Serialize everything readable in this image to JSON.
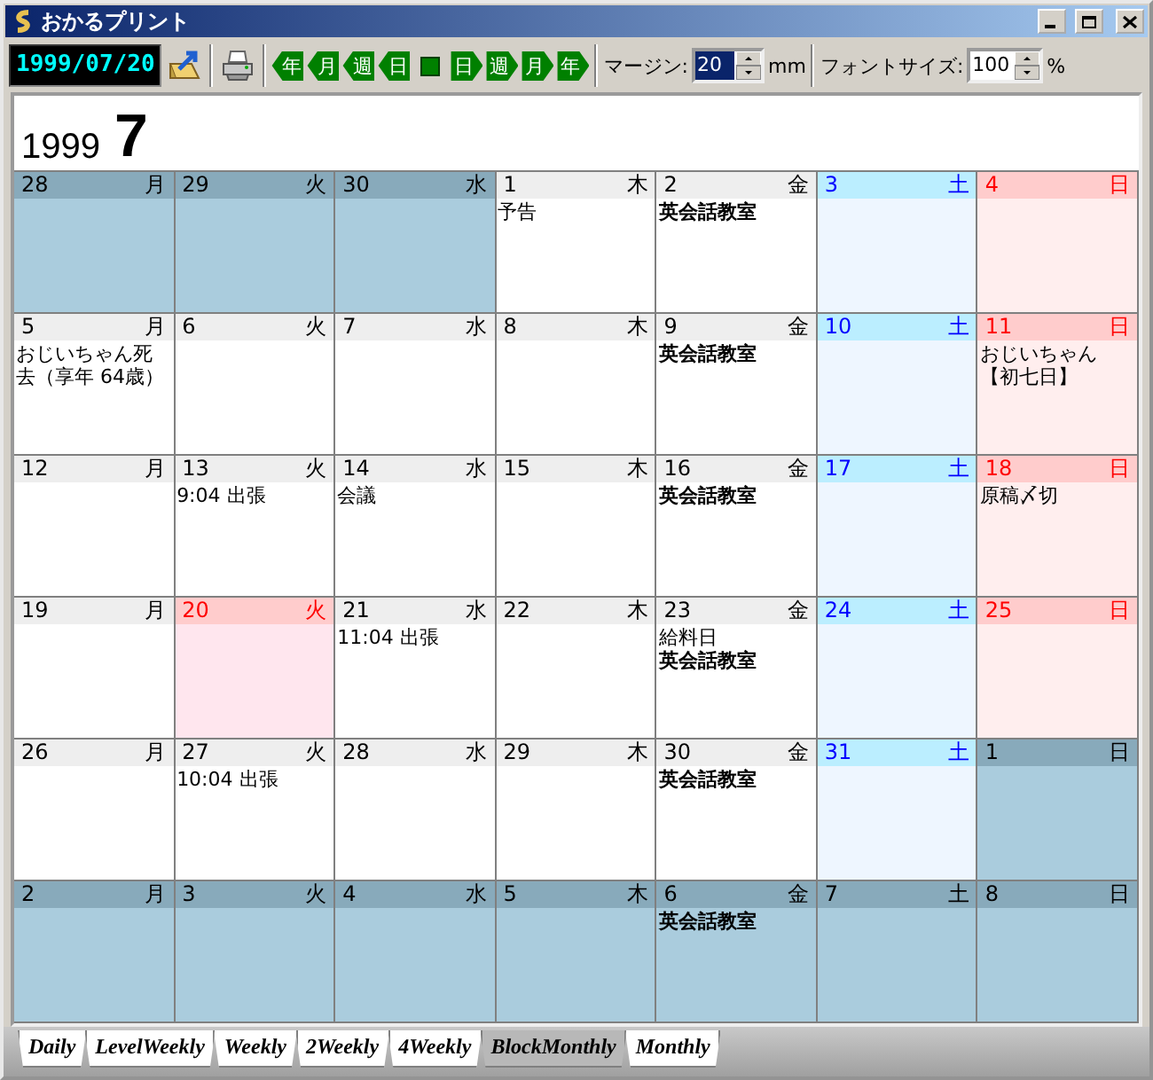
{
  "window": {
    "title": "おかるプリント"
  },
  "toolbar": {
    "date": "1999/07/20",
    "nav": [
      {
        "label": "年",
        "kind": "back"
      },
      {
        "label": "月",
        "kind": "back"
      },
      {
        "label": "週",
        "kind": "back"
      },
      {
        "label": "日",
        "kind": "back"
      },
      {
        "kind": "today"
      },
      {
        "label": "日",
        "kind": "forward"
      },
      {
        "label": "週",
        "kind": "forward"
      },
      {
        "label": "月",
        "kind": "forward"
      },
      {
        "label": "年",
        "kind": "forward"
      }
    ],
    "margin": {
      "label": "マージン:",
      "value": "20",
      "unit": "mm"
    },
    "font_size": {
      "label": "フォントサイズ:",
      "value": "100",
      "unit": "%"
    }
  },
  "heading": {
    "year": "1999",
    "month": "7"
  },
  "weeks": [
    [
      {
        "day": "28",
        "weekday": "月",
        "kind": "other"
      },
      {
        "day": "29",
        "weekday": "火",
        "kind": "other"
      },
      {
        "day": "30",
        "weekday": "水",
        "kind": "other"
      },
      {
        "day": "1",
        "weekday": "木",
        "kind": "normal",
        "events": [
          {
            "text": "予告",
            "bold": false
          }
        ]
      },
      {
        "day": "2",
        "weekday": "金",
        "kind": "normal",
        "events": [
          {
            "text": "英会話教室",
            "bold": true
          }
        ]
      },
      {
        "day": "3",
        "weekday": "土",
        "kind": "saturday"
      },
      {
        "day": "4",
        "weekday": "日",
        "kind": "sunday"
      }
    ],
    [
      {
        "day": "5",
        "weekday": "月",
        "kind": "normal",
        "events": [
          {
            "text": "おじいちゃん死去（享年 64歳）",
            "bold": false
          }
        ]
      },
      {
        "day": "6",
        "weekday": "火",
        "kind": "normal"
      },
      {
        "day": "7",
        "weekday": "水",
        "kind": "normal"
      },
      {
        "day": "8",
        "weekday": "木",
        "kind": "normal"
      },
      {
        "day": "9",
        "weekday": "金",
        "kind": "normal",
        "events": [
          {
            "text": "英会話教室",
            "bold": true
          }
        ]
      },
      {
        "day": "10",
        "weekday": "土",
        "kind": "saturday"
      },
      {
        "day": "11",
        "weekday": "日",
        "kind": "sunday",
        "events": [
          {
            "text": "おじいちゃん【初七日】",
            "bold": false
          }
        ]
      }
    ],
    [
      {
        "day": "12",
        "weekday": "月",
        "kind": "normal"
      },
      {
        "day": "13",
        "weekday": "火",
        "kind": "normal",
        "events": [
          {
            "text": "9:04 出張",
            "bold": false
          }
        ]
      },
      {
        "day": "14",
        "weekday": "水",
        "kind": "normal",
        "events": [
          {
            "text": "会議",
            "bold": false
          }
        ]
      },
      {
        "day": "15",
        "weekday": "木",
        "kind": "normal"
      },
      {
        "day": "16",
        "weekday": "金",
        "kind": "normal",
        "events": [
          {
            "text": "英会話教室",
            "bold": true
          }
        ]
      },
      {
        "day": "17",
        "weekday": "土",
        "kind": "saturday"
      },
      {
        "day": "18",
        "weekday": "日",
        "kind": "sunday",
        "events": [
          {
            "text": "原稿〆切",
            "bold": false
          }
        ]
      }
    ],
    [
      {
        "day": "19",
        "weekday": "月",
        "kind": "normal"
      },
      {
        "day": "20",
        "weekday": "火",
        "kind": "holiday"
      },
      {
        "day": "21",
        "weekday": "水",
        "kind": "normal",
        "events": [
          {
            "text": "11:04 出張",
            "bold": false
          }
        ]
      },
      {
        "day": "22",
        "weekday": "木",
        "kind": "normal"
      },
      {
        "day": "23",
        "weekday": "金",
        "kind": "normal",
        "events": [
          {
            "text": "給料日",
            "bold": false
          },
          {
            "text": "英会話教室",
            "bold": true
          }
        ]
      },
      {
        "day": "24",
        "weekday": "土",
        "kind": "saturday"
      },
      {
        "day": "25",
        "weekday": "日",
        "kind": "sunday"
      }
    ],
    [
      {
        "day": "26",
        "weekday": "月",
        "kind": "normal"
      },
      {
        "day": "27",
        "weekday": "火",
        "kind": "normal",
        "events": [
          {
            "text": "10:04 出張",
            "bold": false
          }
        ]
      },
      {
        "day": "28",
        "weekday": "水",
        "kind": "normal"
      },
      {
        "day": "29",
        "weekday": "木",
        "kind": "normal"
      },
      {
        "day": "30",
        "weekday": "金",
        "kind": "normal",
        "events": [
          {
            "text": "英会話教室",
            "bold": true
          }
        ]
      },
      {
        "day": "31",
        "weekday": "土",
        "kind": "saturday"
      },
      {
        "day": "1",
        "weekday": "日",
        "kind": "other"
      }
    ],
    [
      {
        "day": "2",
        "weekday": "月",
        "kind": "other"
      },
      {
        "day": "3",
        "weekday": "火",
        "kind": "other"
      },
      {
        "day": "4",
        "weekday": "水",
        "kind": "other"
      },
      {
        "day": "5",
        "weekday": "木",
        "kind": "other"
      },
      {
        "day": "6",
        "weekday": "金",
        "kind": "other",
        "events": [
          {
            "text": "英会話教室",
            "bold": true
          }
        ]
      },
      {
        "day": "7",
        "weekday": "土",
        "kind": "other"
      },
      {
        "day": "8",
        "weekday": "日",
        "kind": "other"
      }
    ]
  ],
  "tabs": [
    {
      "label": "Daily",
      "selected": false
    },
    {
      "label": "LevelWeekly",
      "selected": false
    },
    {
      "label": "Weekly",
      "selected": false
    },
    {
      "label": "2Weekly",
      "selected": false
    },
    {
      "label": "4Weekly",
      "selected": false
    },
    {
      "label": "BlockMonthly",
      "selected": true
    },
    {
      "label": "Monthly",
      "selected": false
    }
  ]
}
